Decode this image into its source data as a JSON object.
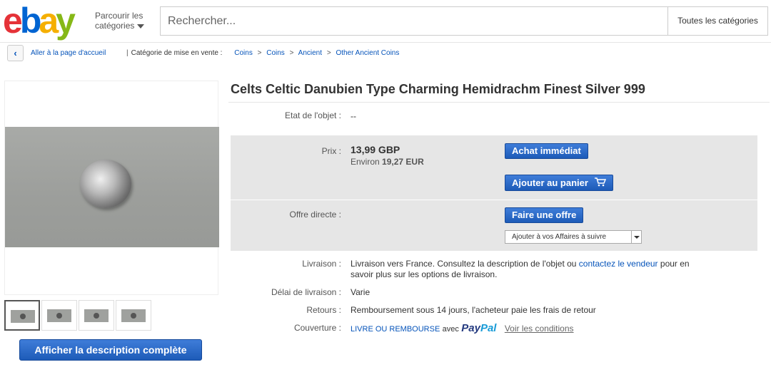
{
  "header": {
    "logo": {
      "e": "e",
      "b": "b",
      "a": "a",
      "y": "y"
    },
    "browse_line1": "Parcourir les",
    "browse_line2": "catégories",
    "search_placeholder": "Rechercher...",
    "category_select": "Toutes les catégories"
  },
  "breadcrumb": {
    "home": "Aller à la page d'accueil",
    "category_label": "Catégorie de mise en vente :",
    "items": [
      "Coins",
      "Coins",
      "Ancient",
      "Other Ancient Coins"
    ],
    "separator": ">"
  },
  "gallery": {
    "thumbnails": 4,
    "description_button": "Afficher la description complète"
  },
  "item": {
    "title": "Celts Celtic Danubien Type Charming Hemidrachm Finest Silver 999",
    "condition_label": "Etat de l'objet :",
    "condition_value": "--",
    "price_label": "Prix :",
    "price": "13,99 GBP",
    "approx_prefix": "Environ",
    "approx_value": "19,27 EUR",
    "buy_now": "Achat immédiat",
    "add_to_cart": "Ajouter au panier",
    "offer_label": "Offre directe :",
    "make_offer": "Faire une offre",
    "watch_select": "Ajouter à vos Affaires à suivre",
    "shipping_label": "Livraison :",
    "shipping_text1": "Livraison vers France. Consultez la description de l'objet ou",
    "shipping_link": "contactez le vendeur",
    "shipping_text2": "pour en",
    "shipping_text3": "savoir plus sur les options de livraison.",
    "delay_label": "Délai de livraison :",
    "delay_value": "Varie",
    "returns_label": "Retours :",
    "returns_value": "Remboursement sous 14 jours, l'acheteur paie les frais de retour",
    "coverage_label": "Couverture :",
    "coverage_text": "LIVRE OU REMBOURSE",
    "coverage_avec": "avec",
    "paypal_1": "Pay",
    "paypal_2": "Pal",
    "see_conditions": "Voir les conditions"
  }
}
